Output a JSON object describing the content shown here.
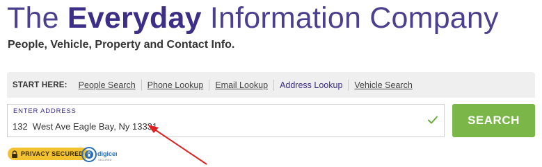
{
  "header": {
    "title_prefix": "The ",
    "title_bold": "Everyday",
    "title_suffix": " Information Company",
    "tagline": "People, Vehicle, Property and Contact Info."
  },
  "tabs": {
    "start_label": "START HERE:",
    "items": [
      {
        "label": "People Search"
      },
      {
        "label": "Phone Lookup"
      },
      {
        "label": "Email Lookup"
      },
      {
        "label": "Address Lookup",
        "active": true
      },
      {
        "label": "Vehicle Search"
      }
    ]
  },
  "address": {
    "label": "ENTER ADDRESS",
    "value": "132  West Ave Eagle Bay, Ny 13331"
  },
  "search": {
    "button_label": "SEARCH"
  },
  "badges": {
    "privacy": "PRIVACY SECURED",
    "digicert": "digicert",
    "digicert_sub": "SECURED"
  },
  "icons": {
    "check": "check-icon",
    "lock": "lock-icon",
    "arrow": "red-arrow-annotation"
  },
  "colors": {
    "brand_purple": "#3d2e87",
    "search_green": "#7ab648",
    "check_green": "#6aad3d",
    "badge_yellow": "#f2c230",
    "arrow_red": "#e02020"
  }
}
